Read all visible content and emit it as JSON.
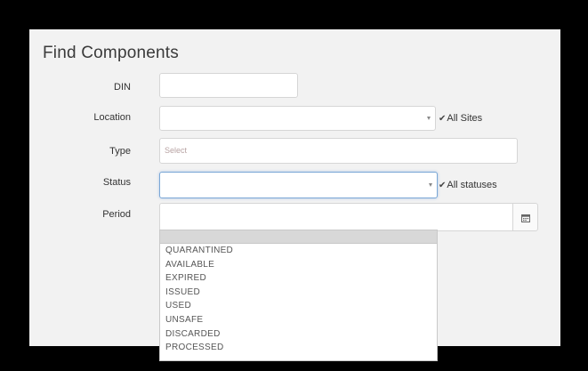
{
  "form": {
    "title": "Find Components",
    "din_label": "DIN",
    "din_value": "",
    "location_label": "Location",
    "location_value": "",
    "all_sites_label": "All Sites",
    "all_sites_checked": true,
    "type_label": "Type",
    "type_placeholder": "Select",
    "status_label": "Status",
    "status_value": "",
    "all_statuses_label": "All statuses",
    "all_statuses_checked": true,
    "period_label": "Period",
    "period_value": ""
  },
  "status_options": [
    "QUARANTINED",
    "AVAILABLE",
    "EXPIRED",
    "ISSUED",
    "USED",
    "UNSAFE",
    "DISCARDED",
    "PROCESSED"
  ],
  "icons": {
    "calendar": "calendar-icon",
    "dropdown": "chevron-down-icon",
    "check": "checkmark-icon"
  }
}
